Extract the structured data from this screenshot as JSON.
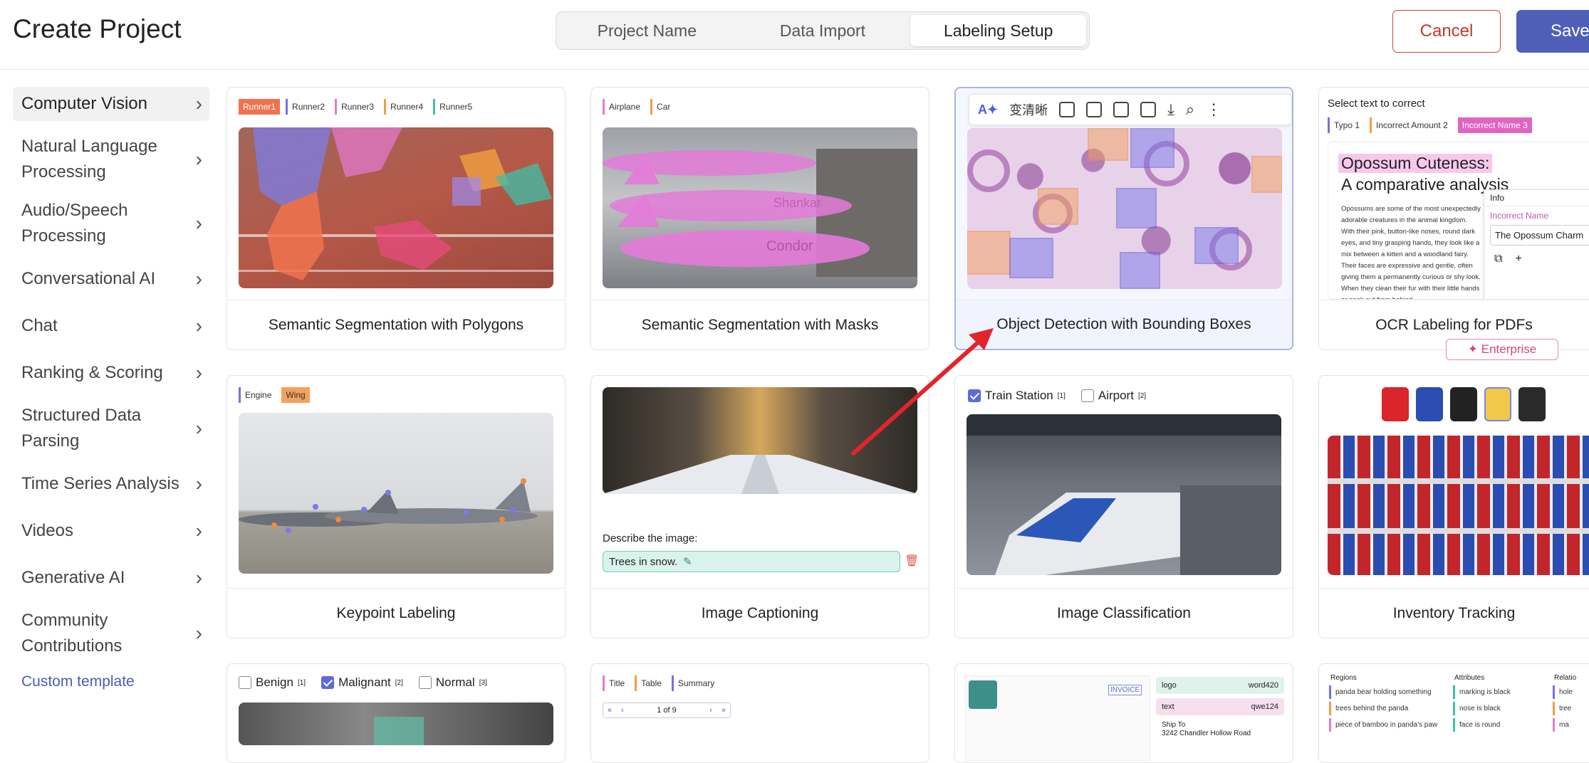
{
  "header": {
    "title": "Create Project",
    "steps": [
      "Project Name",
      "Data Import",
      "Labeling Setup"
    ],
    "cancel": "Cancel",
    "save": "Save"
  },
  "sidebar": {
    "items": [
      "Computer Vision",
      "Natural Language Processing",
      "Audio/Speech Processing",
      "Conversational AI",
      "Chat",
      "Ranking & Scoring",
      "Structured Data Parsing",
      "Time Series Analysis",
      "Videos",
      "Generative AI",
      "Community Contributions"
    ],
    "custom": "Custom template"
  },
  "cards": {
    "c1": {
      "title": "Semantic Segmentation with Polygons",
      "chips": [
        "Runner1",
        "Runner2",
        "Runner3",
        "Runner4",
        "Runner5"
      ]
    },
    "c2": {
      "title": "Semantic Segmentation with Masks",
      "chips": [
        "Airplane",
        "Car"
      ],
      "plane_text_1": "Shankar",
      "plane_text_2": "Condor"
    },
    "c3": {
      "title": "Object Detection with Bounding Boxes",
      "toolbar_text": "变清晰"
    },
    "c4": {
      "title": "OCR Labeling for PDFs",
      "prompt": "Select text to correct",
      "chips": [
        "Typo 1",
        "Incorrect Amount 2",
        "Incorrect Name 3"
      ],
      "doc_title_1": "Opossum Cuteness:",
      "doc_title_2": "A comparative analysis",
      "body": "Opossums are some of the most unexpectedly adorable creatures in the animal kingdom. With their pink, button-like noses, round dark eyes, and tiny grasping hands, they look like a mix between a kitten and a woodland fairy. Their faces are expressive and gentle, often giving them a permanently curious or shy look. When they clean their fur with their little hands or peek out from behind",
      "panel_label": "Info",
      "panel_tag": "Incorrect Name",
      "panel_value": "The Opossum Charm",
      "enterprise": "Enterprise"
    },
    "c5": {
      "title": "Keypoint Labeling",
      "chips": [
        "Engine",
        "Wing"
      ]
    },
    "c6": {
      "title": "Image Captioning",
      "prompt": "Describe the image:",
      "caption": "Trees in snow."
    },
    "c7": {
      "title": "Image Classification",
      "options": [
        "Train Station",
        "Airport"
      ]
    },
    "c8": {
      "title": "Inventory Tracking"
    },
    "c9": {
      "options": [
        "Benign",
        "Malignant",
        "Normal"
      ]
    },
    "c10": {
      "chips": [
        "Title",
        "Table",
        "Summary"
      ],
      "pager": "1 of 9"
    },
    "c11": {
      "fields": [
        "logo",
        "text"
      ],
      "words": [
        "word420",
        "qwe124"
      ],
      "invoice": "INVOICE",
      "ship": "Ship To",
      "address": "3242 Chandler Hollow Road"
    },
    "c12": {
      "regions_head": "Regions",
      "attributes_head": "Attributes",
      "relations_head": "Relatio",
      "regions": [
        "panda bear holding something",
        "trees behind the panda",
        "piece of bamboo in panda's paw"
      ],
      "attributes": [
        "marking is black",
        "nose is black",
        "face is round"
      ],
      "relations": [
        "hole",
        "tree",
        "ma"
      ]
    }
  },
  "colors": {
    "accent": "#4f5fb8",
    "cancel": "#c0392b",
    "arrow": "#e3242b"
  }
}
